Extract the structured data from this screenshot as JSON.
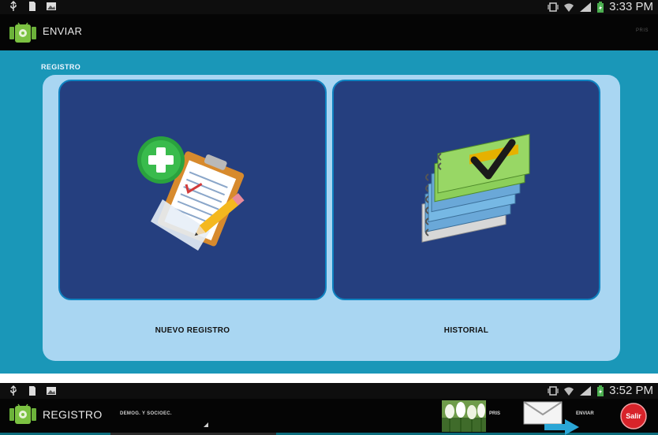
{
  "top": {
    "status_time": "3:33 PM",
    "action_bar_title": "ENVIAR",
    "action_bar_right": "PRIS"
  },
  "main": {
    "section_title": "REGISTRO",
    "tiles": [
      {
        "label": "NUEVO REGISTRO",
        "icon": "new-record-clipboard-icon"
      },
      {
        "label": "HISTORIAL",
        "icon": "history-notebooks-icon"
      }
    ]
  },
  "bottom": {
    "status_time": "3:52 PM",
    "action_bar_title": "REGISTRO",
    "subtitle": "DEMOG. Y SOCIOEC.",
    "pris_label": "PRIS",
    "enviar_label": "ENVIAR",
    "salir_label": "Salir"
  },
  "colors": {
    "content_bg": "#1a97b8",
    "panel_bg": "#a9d6f2",
    "tile_bg": "#253f7f",
    "tile_border": "#0f82c0",
    "bar_bg": "#050505"
  }
}
